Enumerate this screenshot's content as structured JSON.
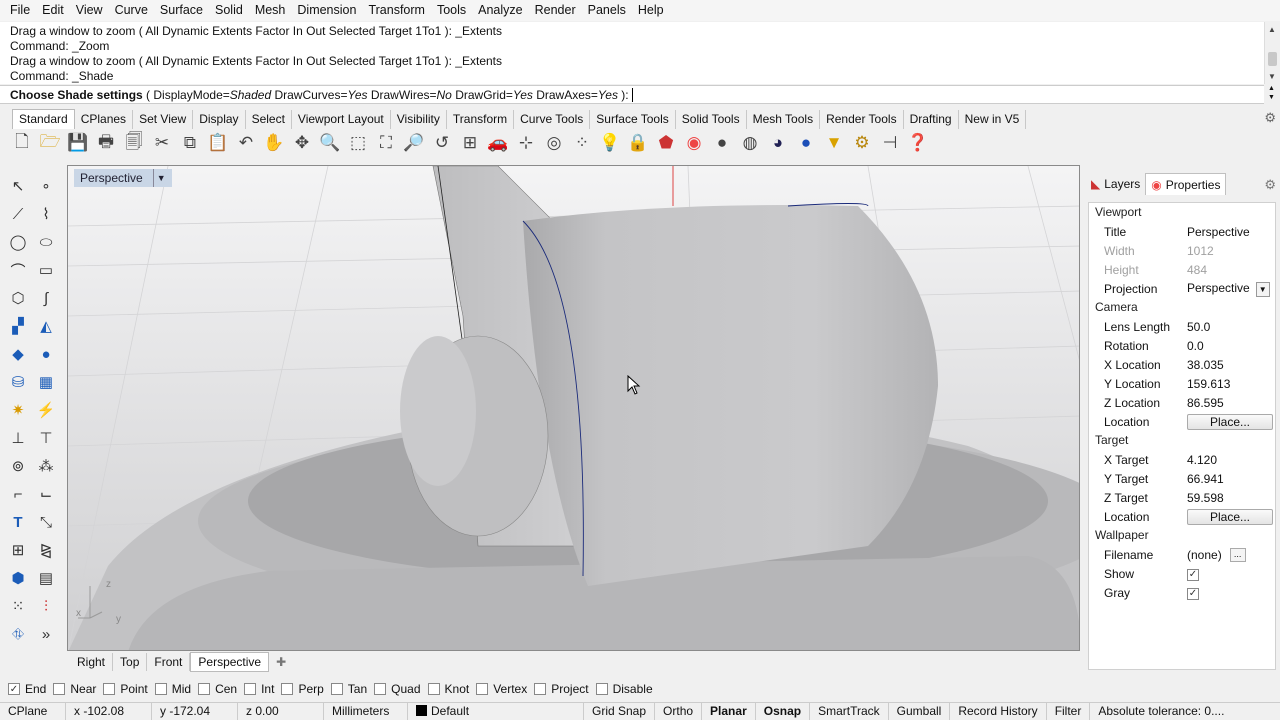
{
  "menu": [
    "File",
    "Edit",
    "View",
    "Curve",
    "Surface",
    "Solid",
    "Mesh",
    "Dimension",
    "Transform",
    "Tools",
    "Analyze",
    "Render",
    "Panels",
    "Help"
  ],
  "command_history": [
    "Drag a window to zoom ( All  Dynamic  Extents  Factor  In  Out  Selected  Target  1To1 ): _Extents",
    "Command: _Zoom",
    "Drag a window to zoom ( All  Dynamic  Extents  Factor  In  Out  Selected  Target  1To1 ): _Extents",
    "Command: _Shade"
  ],
  "prompt": {
    "label": "Choose Shade settings",
    "open": " ( ",
    "o1_name": "DisplayMode=",
    "o1_val": "Shaded",
    "o2_name": "  DrawCurves=",
    "o2_val": "Yes",
    "o3_name": "  DrawWires=",
    "o3_val": "No",
    "o4_name": "  DrawGrid=",
    "o4_val": "Yes",
    "o5_name": "  DrawAxes=",
    "o5_val": "Yes",
    "close": " ):"
  },
  "toolbar_tabs": [
    "Standard",
    "CPlanes",
    "Set View",
    "Display",
    "Select",
    "Viewport Layout",
    "Visibility",
    "Transform",
    "Curve Tools",
    "Surface Tools",
    "Solid Tools",
    "Mesh Tools",
    "Render Tools",
    "Drafting",
    "New in V5"
  ],
  "viewport": {
    "title": "Perspective",
    "axes": {
      "z": "z",
      "x": "x",
      "y": "y"
    }
  },
  "viewport_tabs": [
    "Right",
    "Top",
    "Front",
    "Perspective"
  ],
  "panel": {
    "tabs": [
      "Layers",
      "Properties"
    ],
    "sections": {
      "viewport": "Viewport",
      "camera": "Camera",
      "target": "Target",
      "wallpaper": "Wallpaper"
    },
    "title_label": "Title",
    "title_value": "Perspective",
    "width_label": "Width",
    "width_value": "1012",
    "height_label": "Height",
    "height_value": "484",
    "projection_label": "Projection",
    "projection_value": "Perspective",
    "lens_label": "Lens Length",
    "lens_value": "50.0",
    "rotation_label": "Rotation",
    "rotation_value": "0.0",
    "xloc_label": "X Location",
    "xloc_value": "38.035",
    "yloc_label": "Y Location",
    "yloc_value": "159.613",
    "zloc_label": "Z Location",
    "zloc_value": "86.595",
    "location_label": "Location",
    "place_label": "Place...",
    "xt_label": "X Target",
    "xt_value": "4.120",
    "yt_label": "Y Target",
    "yt_value": "66.941",
    "zt_label": "Z Target",
    "zt_value": "59.598",
    "filename_label": "Filename",
    "filename_value": "(none)",
    "show_label": "Show",
    "gray_label": "Gray"
  },
  "osnaps": [
    {
      "label": "End",
      "checked": true
    },
    {
      "label": "Near",
      "checked": false
    },
    {
      "label": "Point",
      "checked": false
    },
    {
      "label": "Mid",
      "checked": false
    },
    {
      "label": "Cen",
      "checked": false
    },
    {
      "label": "Int",
      "checked": false
    },
    {
      "label": "Perp",
      "checked": false
    },
    {
      "label": "Tan",
      "checked": false
    },
    {
      "label": "Quad",
      "checked": false
    },
    {
      "label": "Knot",
      "checked": false
    },
    {
      "label": "Vertex",
      "checked": false
    },
    {
      "label": "Project",
      "checked": false
    },
    {
      "label": "Disable",
      "checked": false
    }
  ],
  "status": {
    "cplane": "CPlane",
    "x": "x -102.08",
    "y": "y -172.04",
    "z": "z 0.00",
    "units": "Millimeters",
    "layer": "Default",
    "grid_snap": "Grid Snap",
    "ortho": "Ortho",
    "planar": "Planar",
    "osnap": "Osnap",
    "smarttrack": "SmartTrack",
    "gumball": "Gumball",
    "history": "Record History",
    "filter": "Filter",
    "tolerance": "Absolute tolerance: 0...."
  },
  "colors": {
    "viewport_title_bg": "#c9d6e6",
    "layer_swatch": "#000000"
  }
}
